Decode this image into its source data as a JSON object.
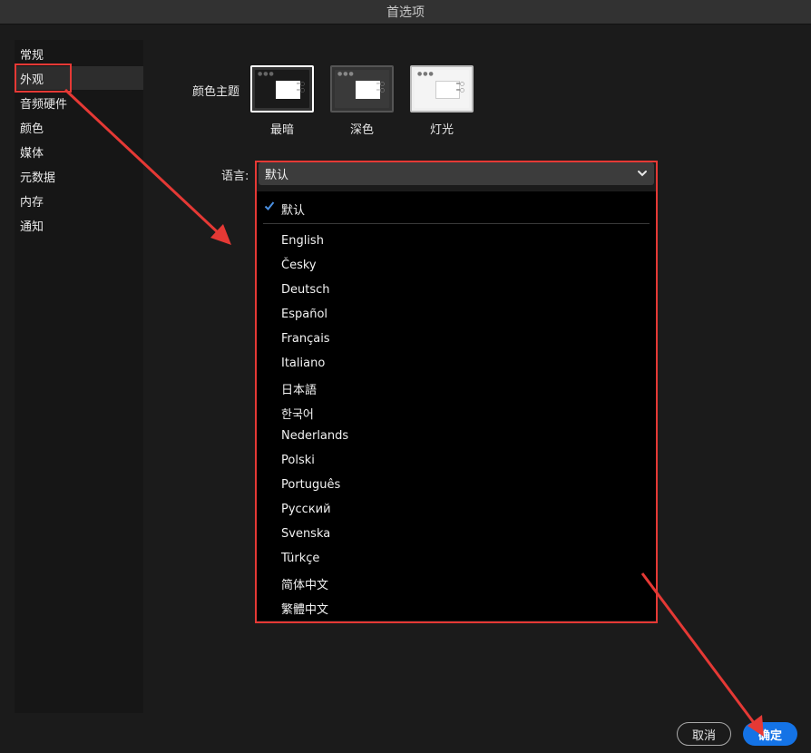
{
  "window": {
    "title": "首选项"
  },
  "sidebar": {
    "items": [
      {
        "label": "常规"
      },
      {
        "label": "外观"
      },
      {
        "label": "音频硬件"
      },
      {
        "label": "颜色"
      },
      {
        "label": "媒体"
      },
      {
        "label": "元数据"
      },
      {
        "label": "内存"
      },
      {
        "label": "通知"
      }
    ],
    "selected_index": 1
  },
  "appearance": {
    "color_theme_label": "颜色主题",
    "themes": [
      {
        "label": "最暗"
      },
      {
        "label": "深色"
      },
      {
        "label": "灯光"
      }
    ],
    "selected_theme_index": 0
  },
  "language": {
    "label": "语言:",
    "selected": "默认",
    "options": [
      "默认",
      "English",
      "Česky",
      "Deutsch",
      "Español",
      "Français",
      "Italiano",
      "日本語",
      "한국어",
      "Nederlands",
      "Polski",
      "Português",
      "Русский",
      "Svenska",
      "Türkçe",
      "简体中文",
      "繁體中文"
    ]
  },
  "footer": {
    "cancel_label": "取消",
    "ok_label": "确定"
  },
  "colors": {
    "accent": "#1473e6",
    "annotation_red": "#e53935",
    "check": "#4a90e2"
  }
}
